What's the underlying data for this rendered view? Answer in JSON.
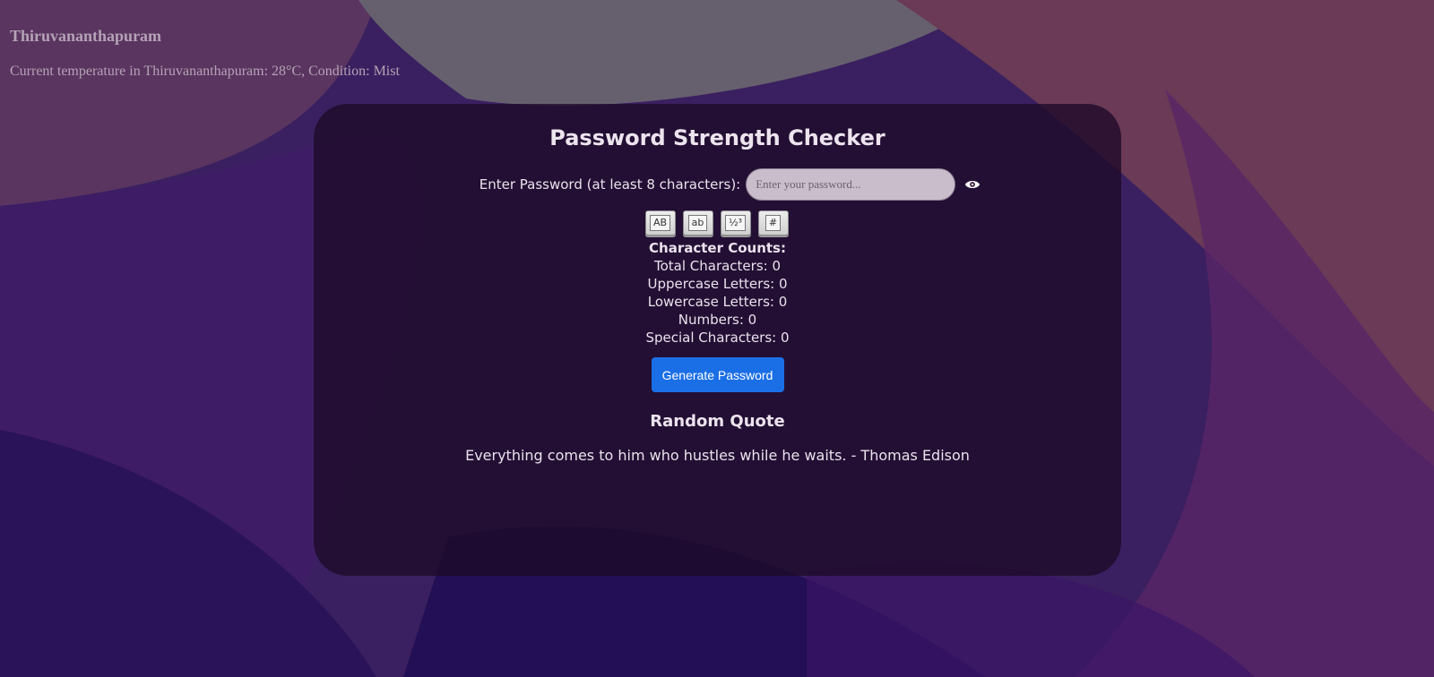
{
  "weather": {
    "city": "Thiruvananthapuram",
    "description": "Current temperature in Thiruvananthapuram: 28°C, Condition: Mist"
  },
  "checker": {
    "title": "Password Strength Checker",
    "password_label": "Enter Password (at least 8 characters):",
    "password_placeholder": "Enter your password...",
    "password_value": "",
    "toggle_icon": "eye-icon",
    "char_type_keys": [
      {
        "label": "AB",
        "icon": "uppercase-key-icon"
      },
      {
        "label": "ab",
        "icon": "lowercase-key-icon"
      },
      {
        "label": "½³",
        "icon": "numbers-key-icon"
      },
      {
        "label": "#",
        "icon": "special-char-key-icon"
      }
    ],
    "counts": {
      "heading": "Character Counts:",
      "total": "Total Characters: 0",
      "uppercase": "Uppercase Letters: 0",
      "lowercase": "Lowercase Letters: 0",
      "numbers": "Numbers: 0",
      "special": "Special Characters: 0"
    },
    "generate_button": "Generate Password"
  },
  "quote": {
    "title": "Random Quote",
    "text": "Everything comes to him who hustles while he waits. - Thomas Edison"
  },
  "colors": {
    "accent_button": "#1b6fe6",
    "card_background": "#1e0a28",
    "text": "#eae2ec"
  }
}
